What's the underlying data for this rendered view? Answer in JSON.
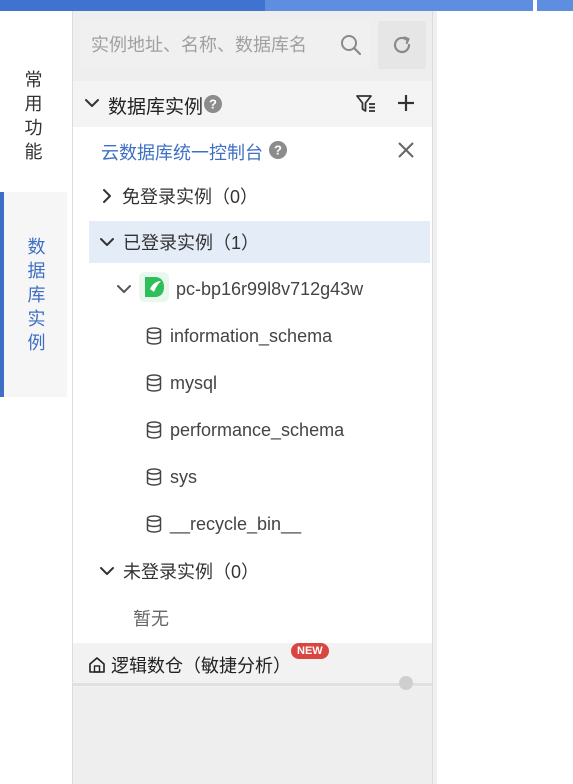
{
  "leftnav": {
    "common": "常用功能",
    "database": "数据库实例"
  },
  "search": {
    "placeholder": "实例地址、名称、数据库名"
  },
  "section": {
    "title": "数据库实例"
  },
  "console": {
    "label": "云数据库统一控制台"
  },
  "groups": {
    "free_login": "免登录实例（0）",
    "logged_in": "已登录实例（1）",
    "not_logged_in": "未登录实例（0）",
    "empty": "暂无"
  },
  "instance": {
    "name": "pc-bp16r99l8v712g43w",
    "databases": [
      "information_schema",
      "mysql",
      "performance_schema",
      "sys",
      "__recycle_bin__"
    ]
  },
  "logic": {
    "label": "逻辑数仓（敏捷分析）",
    "badge": "NEW"
  },
  "colors": {
    "accent": "#3e6fc4",
    "badge": "#d9453f",
    "instance_icon": "#2fbf5a"
  }
}
